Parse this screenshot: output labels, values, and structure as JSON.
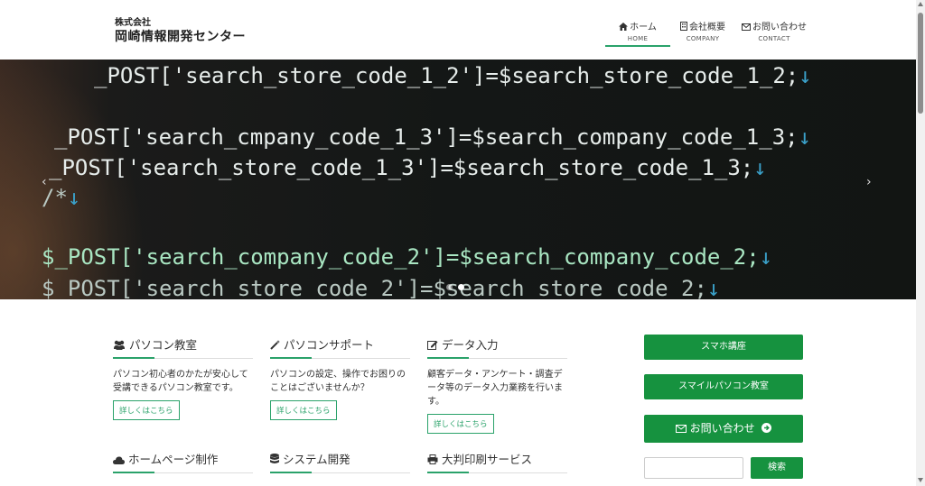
{
  "header": {
    "company_prefix": "株式会社",
    "company_name": "岡崎情報開発センター",
    "nav": [
      {
        "label": "ホーム",
        "sub": "HOME",
        "icon": "home-icon"
      },
      {
        "label": "会社概要",
        "sub": "COMPANY",
        "icon": "building-icon"
      },
      {
        "label": "お問い合わせ",
        "sub": "CONTACT",
        "icon": "mail-icon"
      }
    ]
  },
  "hero": {
    "lines": [
      "_POST['search_store_code_1_2']=$search_store_code_1_2;",
      "_POST['search_cmpany_code_1_3']=$search_company_code_1_3;",
      "_POST['search_store_code_1_3']=$search_store_code_1_3;",
      "/*",
      "$_POST['search_company_code_2']=$search_company_code_2;",
      "$_POST['search_store_code_2']=$search_store_code_2;"
    ],
    "arrow": "↓",
    "prev": "‹",
    "next": "›"
  },
  "services": [
    {
      "title": "パソコン教室",
      "icon": "users-icon",
      "desc": "パソコン初心者のかたが安心して受講できるパソコン教室です。",
      "more": "詳しくはこちら"
    },
    {
      "title": "パソコンサポート",
      "icon": "wand-icon",
      "desc": "パソコンの設定、操作でお困りのことはございませんか？",
      "more": "詳しくはこちら"
    },
    {
      "title": "データ入力",
      "icon": "edit-icon",
      "desc": "顧客データ・アンケート・調査データ等のデータ入力業務を行います。",
      "more": "詳しくはこちら"
    },
    {
      "title": "ホームページ制作",
      "icon": "cloud-icon",
      "desc": "",
      "more": ""
    },
    {
      "title": "システム開発",
      "icon": "database-icon",
      "desc": "",
      "more": ""
    },
    {
      "title": "大判印刷サービス",
      "icon": "printer-icon",
      "desc": "",
      "more": ""
    }
  ],
  "sidebar": {
    "smartphone_course": "スマホ講座",
    "smile_pc": "スマイルパソコン教室",
    "contact": "お問い合わせ",
    "search_button": "検索",
    "search_placeholder": ""
  },
  "colors": {
    "accent": "#16923f",
    "underline": "#2aa26a"
  }
}
